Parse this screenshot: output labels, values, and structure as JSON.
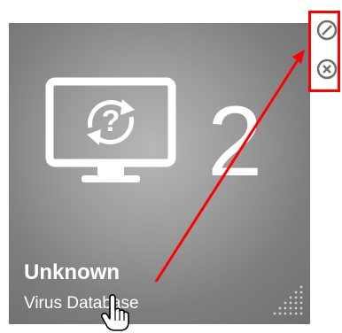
{
  "tile": {
    "count": "2",
    "status_title": "Unknown",
    "status_subtitle": "Virus Database",
    "icon": "monitor-question-sync-icon",
    "background_color": "#8a8a8a"
  },
  "actions": {
    "disable_icon": "disable-icon",
    "remove_icon": "remove-icon",
    "icon_color": "#6f6f6f"
  },
  "annotation": {
    "color": "#ff0000",
    "arrow_icon": "arrow-icon"
  },
  "cursor": {
    "icon": "hand-pointer-icon"
  }
}
